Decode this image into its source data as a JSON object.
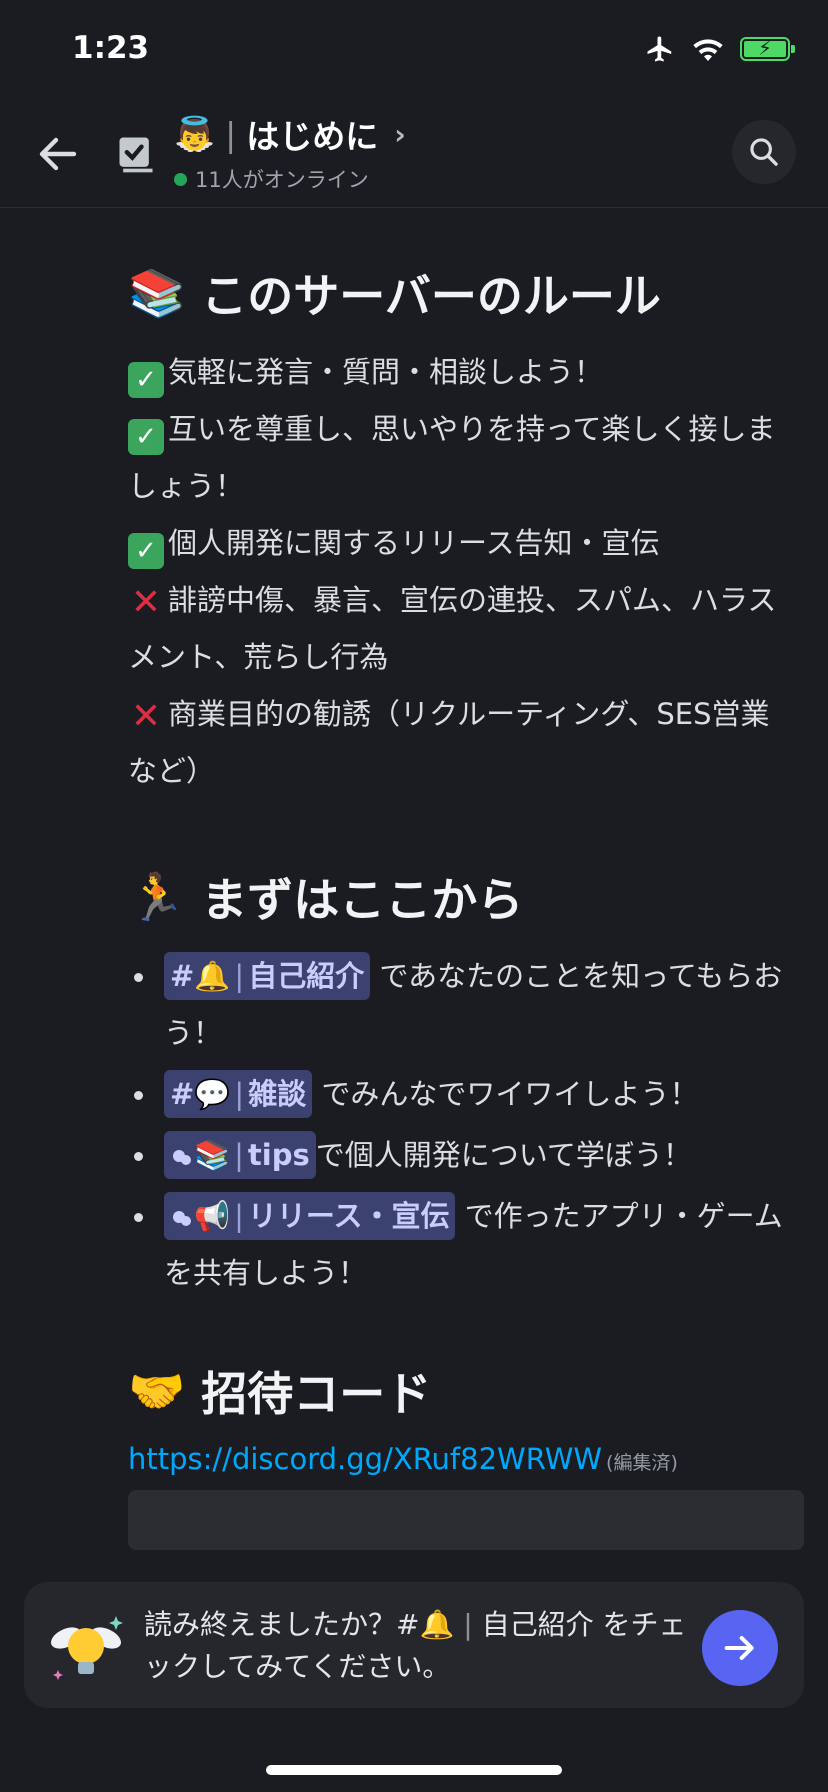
{
  "status_bar": {
    "time": "1:23"
  },
  "header": {
    "channel_emoji": "👼",
    "channel_name": "はじめに",
    "online_text": "11人がオンライン"
  },
  "rules_section": {
    "title": "このサーバーのルール",
    "items": [
      {
        "type": "check",
        "text": "気軽に発言・質問・相談しよう！"
      },
      {
        "type": "check",
        "text": "互いを尊重し、思いやりを持って楽しく接しましょう！"
      },
      {
        "type": "check",
        "text": "個人開発に関するリリース告知・宣伝"
      },
      {
        "type": "cross",
        "text": "誹謗中傷、暴言、宣伝の連投、スパム、ハラスメント、荒らし行為"
      },
      {
        "type": "cross",
        "text": "商業目的の勧誘（リクルーティング、SES営業など）"
      }
    ]
  },
  "start_section": {
    "title": "まずはここから",
    "items": [
      {
        "prefix": "#",
        "emoji": "🔔",
        "channel": "自己紹介",
        "text": " であなたのことを知ってもらおう！"
      },
      {
        "prefix": "#",
        "emoji": "💬",
        "channel": "雑談",
        "text": " でみんなでワイワイしよう！"
      },
      {
        "prefix": "forum",
        "emoji": "📚",
        "channel": "tips",
        "text": "で個人開発について学ぼう！"
      },
      {
        "prefix": "forum",
        "emoji": "📢",
        "channel": "リリース・宣伝",
        "text": " で作ったアプリ・ゲームを共有しよう！"
      }
    ]
  },
  "invite_section": {
    "title": "招待コード",
    "link": "https://discord.gg/XRuf82WRWW",
    "edited": "(編集済)"
  },
  "banner": {
    "text_before": "読み終えましたか？#",
    "emoji": "🔔",
    "channel": "自己紹介",
    "text_after": " をチェックしてみてください。"
  },
  "colors": {
    "accent": "#5865f2",
    "online": "#23a55a",
    "link": "#00a8fc"
  }
}
